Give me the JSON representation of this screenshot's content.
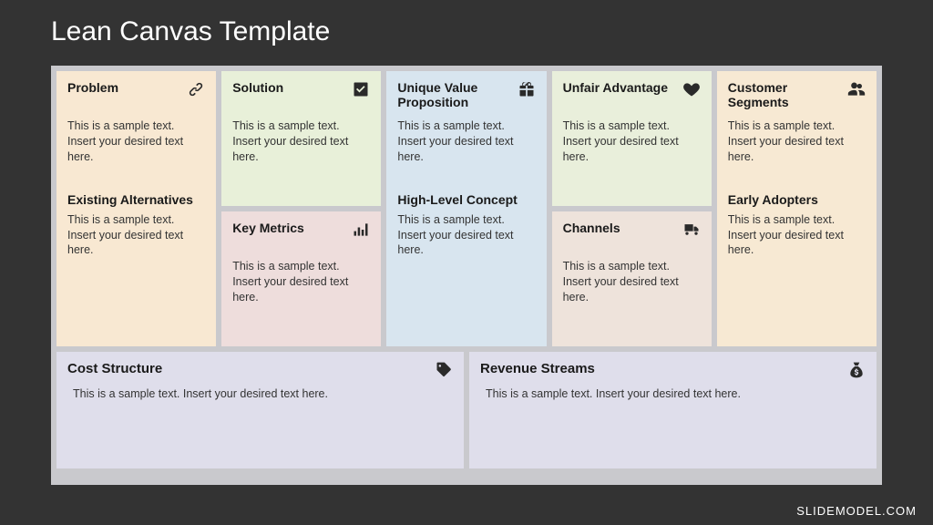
{
  "title": "Lean Canvas Template",
  "watermark": "SLIDEMODEL.COM",
  "cells": {
    "problem": {
      "title": "Problem",
      "body": "This is a sample text. Insert your desired text here.",
      "sub_title": "Existing Alternatives",
      "sub_body": "This is a sample text. Insert your desired text here."
    },
    "solution": {
      "title": "Solution",
      "body": "This is a sample text. Insert your desired text here."
    },
    "uvp": {
      "title": "Unique Value Proposition",
      "body": "This is a sample text. Insert your desired text here.",
      "sub_title": "High-Level Concept",
      "sub_body": "This is a sample text. Insert your desired text here."
    },
    "advantage": {
      "title": "Unfair Advantage",
      "body": "This is a sample text. Insert your desired text here."
    },
    "segments": {
      "title": "Customer Segments",
      "body": "This is a sample text. Insert your desired text here.",
      "sub_title": "Early Adopters",
      "sub_body": "This is a sample text. Insert your desired text here."
    },
    "metrics": {
      "title": "Key Metrics",
      "body": "This is a sample text. Insert your desired text here."
    },
    "channels": {
      "title": "Channels",
      "body": "This is a sample text. Insert your desired text here."
    },
    "cost": {
      "title": "Cost Structure",
      "body": "This is a sample text. Insert your desired text here."
    },
    "revenue": {
      "title": "Revenue Streams",
      "body": "This is a sample text. Insert your desired text here."
    }
  }
}
